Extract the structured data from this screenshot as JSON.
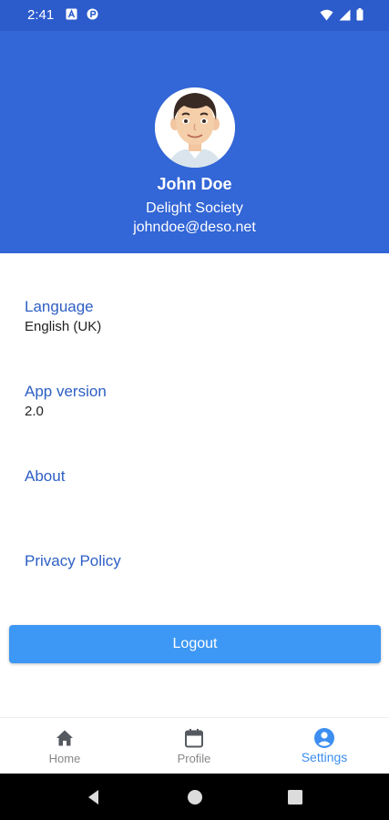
{
  "status_bar": {
    "time": "2:41"
  },
  "header": {
    "name": "John Doe",
    "organization": "Delight Society",
    "email": "johndoe@deso.net"
  },
  "settings": [
    {
      "label": "Language",
      "value": "English (UK)"
    },
    {
      "label": "App version",
      "value": "2.0"
    },
    {
      "label": "About",
      "value": ""
    },
    {
      "label": "Privacy Policy",
      "value": ""
    }
  ],
  "logout_label": "Logout",
  "bottom_nav": [
    {
      "label": "Home",
      "icon": "home-icon",
      "active": false
    },
    {
      "label": "Profile",
      "icon": "calendar-icon",
      "active": false
    },
    {
      "label": "Settings",
      "icon": "account-circle-icon",
      "active": true
    }
  ],
  "colors": {
    "header": "#3366d6",
    "status_bar": "#2c5bcc",
    "accent": "#3d97f4",
    "label": "#2d5fc4"
  }
}
